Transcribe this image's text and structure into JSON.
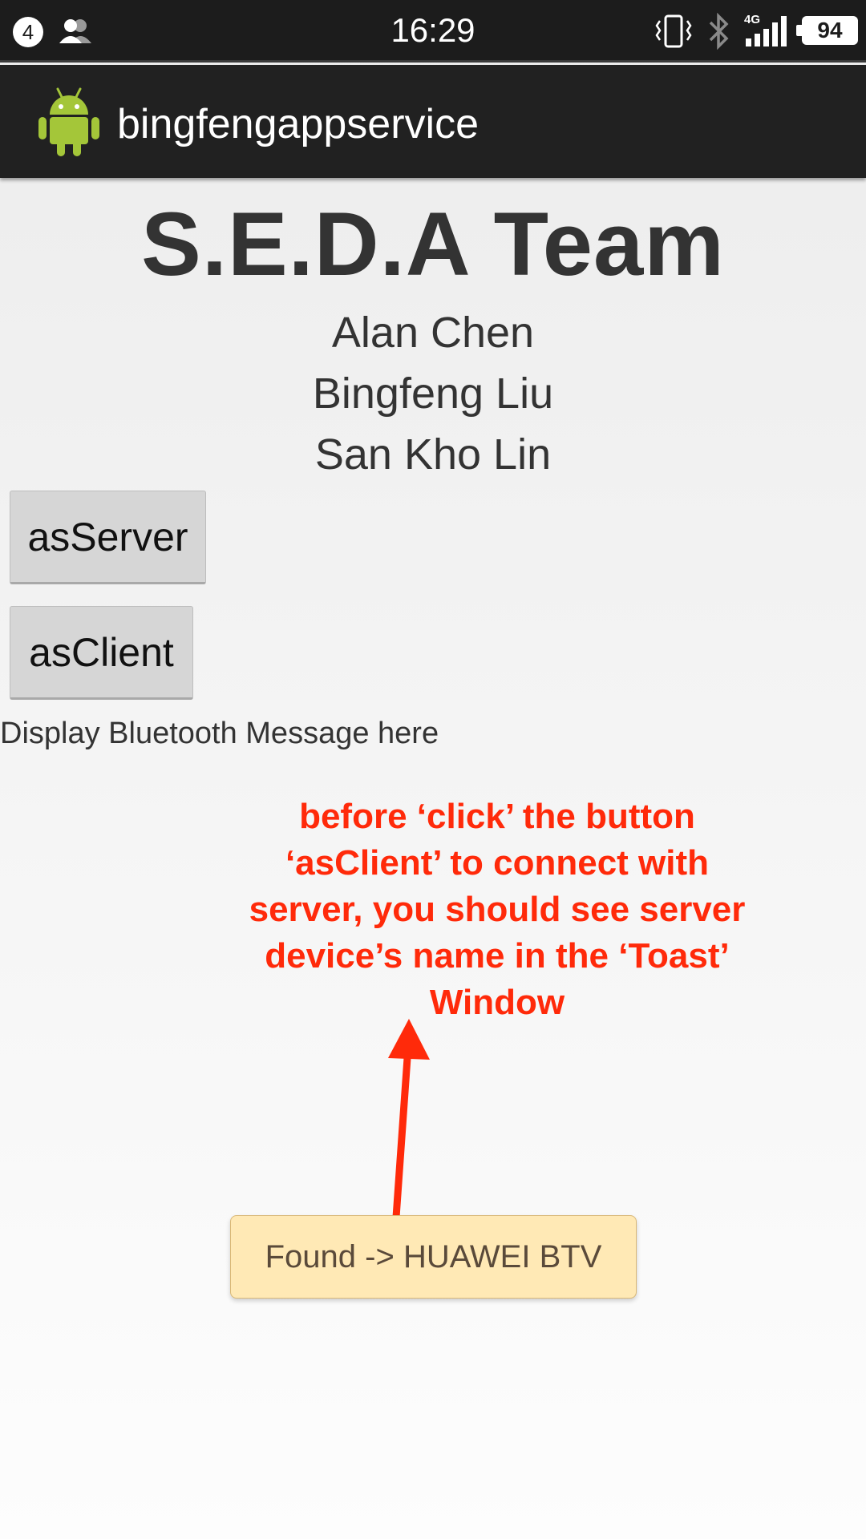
{
  "status_bar": {
    "notification_count": "4",
    "time": "16:29",
    "network_type": "4G",
    "battery": "94"
  },
  "action_bar": {
    "title": "bingfengappservice"
  },
  "main": {
    "team_title": "S.E.D.A Team",
    "members": [
      "Alan Chen",
      "Bingfeng Liu",
      "San Kho Lin"
    ],
    "server_button": "asServer",
    "client_button": "asClient",
    "message": "Display Bluetooth Message here"
  },
  "annotation": {
    "lines": [
      "before ‘click’ the button",
      "‘asClient’ to connect with",
      "server, you should see server",
      "device’s name in the ‘Toast’",
      "Window"
    ],
    "color": "#ff2a0a"
  },
  "toast": {
    "text": "Found -> HUAWEI BTV"
  }
}
